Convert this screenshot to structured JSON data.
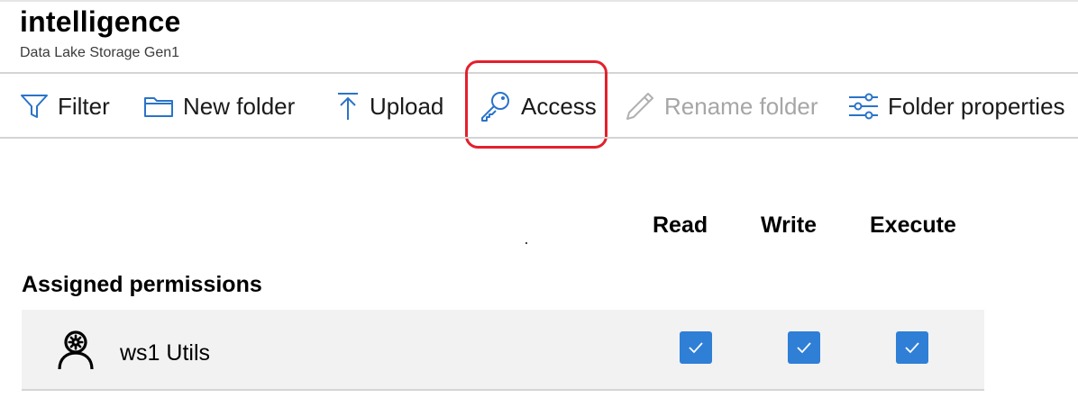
{
  "header": {
    "title": "intelligence",
    "subtitle": "Data Lake Storage Gen1"
  },
  "toolbar": {
    "filter_label": "Filter",
    "new_folder_label": "New folder",
    "upload_label": "Upload",
    "access_label": "Access",
    "rename_folder_label": "Rename folder",
    "folder_properties_label": "Folder properties",
    "rename_folder_disabled": true,
    "highlighted_item": "Access",
    "highlight_color": "#e3202c",
    "icon_color": "#2a73c9"
  },
  "permissions": {
    "columns": [
      "Read",
      "Write",
      "Execute"
    ],
    "section_title": "Assigned permissions",
    "rows": [
      {
        "name": "ws1 Utils",
        "icon": "user-gear-icon",
        "read": true,
        "write": true,
        "execute": true
      }
    ],
    "checkbox_color": "#2f7fd6"
  }
}
